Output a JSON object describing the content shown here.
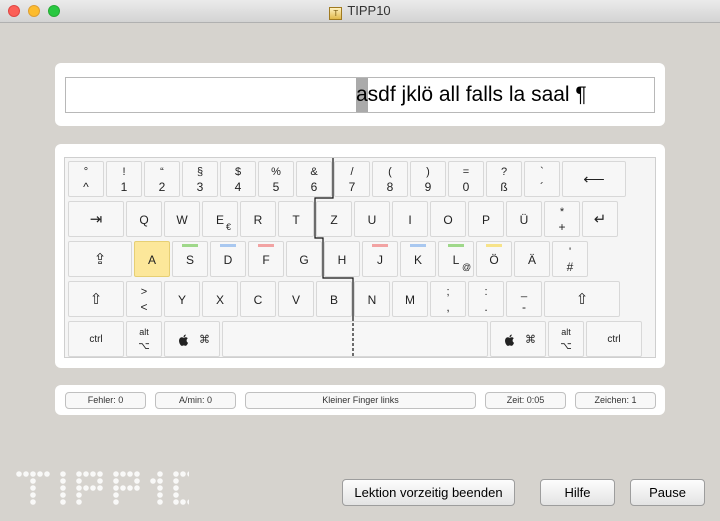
{
  "window": {
    "title": "TIPP10",
    "app_icon_letter": "T"
  },
  "lesson": {
    "text": "asdf jklö all falls la saal ¶"
  },
  "colors": {
    "pinky": "#9fd88a",
    "ring": "#a9c8f0",
    "middle": "#f2a3a3",
    "index": "#f7e38a",
    "highlight": "#fce79a"
  },
  "keyboard": {
    "row1": [
      {
        "up": "°",
        "dn": "^"
      },
      {
        "up": "!",
        "dn": "1"
      },
      {
        "up": "“",
        "dn": "2"
      },
      {
        "up": "§",
        "dn": "3"
      },
      {
        "up": "$",
        "dn": "4"
      },
      {
        "up": "%",
        "dn": "5"
      },
      {
        "up": "&",
        "dn": "6"
      },
      {
        "up": "/",
        "dn": "7"
      },
      {
        "up": "(",
        "dn": "8"
      },
      {
        "up": ")",
        "dn": "9"
      },
      {
        "up": "=",
        "dn": "0"
      },
      {
        "up": "?",
        "dn": "ß"
      },
      {
        "up": "`",
        "dn": "´"
      },
      {
        "ctr": "⟵"
      }
    ],
    "row2": [
      {
        "ctr": "⇥"
      },
      {
        "ctr": "Q"
      },
      {
        "ctr": "W"
      },
      {
        "ctr": "E",
        "alt": "€"
      },
      {
        "ctr": "R"
      },
      {
        "ctr": "T"
      },
      {
        "ctr": "Z"
      },
      {
        "ctr": "U"
      },
      {
        "ctr": "I"
      },
      {
        "ctr": "O"
      },
      {
        "ctr": "P"
      },
      {
        "ctr": "Ü"
      },
      {
        "up": "*",
        "dn": "+"
      },
      {
        "ctr": "↵"
      }
    ],
    "row3": [
      {
        "ctr": "⇪"
      },
      {
        "ctr": "A"
      },
      {
        "ctr": "S"
      },
      {
        "ctr": "D"
      },
      {
        "ctr": "F"
      },
      {
        "ctr": "G"
      },
      {
        "ctr": "H"
      },
      {
        "ctr": "J"
      },
      {
        "ctr": "K"
      },
      {
        "ctr": "L",
        "alt": "@"
      },
      {
        "ctr": "Ö"
      },
      {
        "ctr": "Ä"
      },
      {
        "up": "'",
        "dn": "#"
      }
    ],
    "row4": [
      {
        "ctr": "⇧"
      },
      {
        "up": ">",
        "dn": "<"
      },
      {
        "ctr": "Y"
      },
      {
        "ctr": "X"
      },
      {
        "ctr": "C"
      },
      {
        "ctr": "V"
      },
      {
        "ctr": "B"
      },
      {
        "ctr": "N"
      },
      {
        "ctr": "M"
      },
      {
        "up": ";",
        "dn": ","
      },
      {
        "up": ":",
        "dn": "."
      },
      {
        "up": "_",
        "dn": "-"
      },
      {
        "ctr": "⇧"
      }
    ],
    "row5": [
      {
        "ctr": "ctrl"
      },
      {
        "up": "alt",
        "dn": "⌥"
      },
      {
        "mini1": "",
        "mini2": "⌘"
      },
      {
        "ctr": ""
      },
      {
        "mini1": "",
        "mini2": "⌘"
      },
      {
        "up": "alt",
        "dn": "⌥"
      },
      {
        "ctr": "ctrl"
      }
    ]
  },
  "status": {
    "errors": "Fehler: 0",
    "rate": "A/min: 0",
    "finger": "Kleiner Finger links",
    "time": "Zeit: 0:05",
    "chars": "Zeichen: 1"
  },
  "buttons": {
    "end_lesson": "Lektion vorzeitig beenden",
    "help": "Hilfe",
    "pause": "Pause"
  }
}
